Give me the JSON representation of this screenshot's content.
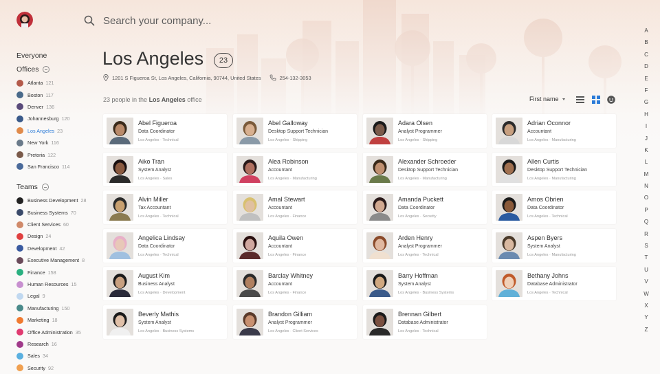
{
  "search": {
    "placeholder": "Search your company..."
  },
  "sidebar": {
    "everyone_label": "Everyone",
    "offices_label": "Offices",
    "teams_label": "Teams",
    "offices": [
      {
        "name": "Atlanta",
        "count": "121",
        "color": "#b45a4a"
      },
      {
        "name": "Boston",
        "count": "117",
        "color": "#4a6a8a"
      },
      {
        "name": "Denver",
        "count": "136",
        "color": "#5a4a7a"
      },
      {
        "name": "Johannesburg",
        "count": "120",
        "color": "#3a5a8a"
      },
      {
        "name": "Los Angeles",
        "count": "23",
        "color": "#e08a4a",
        "active": true
      },
      {
        "name": "New York",
        "count": "116",
        "color": "#6a7a8a"
      },
      {
        "name": "Pretoria",
        "count": "122",
        "color": "#7a5a4a"
      },
      {
        "name": "San Francisco",
        "count": "114",
        "color": "#4a6a9a"
      }
    ],
    "teams": [
      {
        "name": "Business Development",
        "count": "28",
        "color": "#222222"
      },
      {
        "name": "Business Systems",
        "count": "70",
        "color": "#3a4a6a"
      },
      {
        "name": "Client Services",
        "count": "60",
        "color": "#d08a6a"
      },
      {
        "name": "Design",
        "count": "24",
        "color": "#e04040"
      },
      {
        "name": "Development",
        "count": "42",
        "color": "#3a5aa0"
      },
      {
        "name": "Executive Management",
        "count": "8",
        "color": "#6a4a5a"
      },
      {
        "name": "Finance",
        "count": "158",
        "color": "#2ab080"
      },
      {
        "name": "Human Resources",
        "count": "15",
        "color": "#c890d0"
      },
      {
        "name": "Legal",
        "count": "9",
        "color": "#c0d8f0"
      },
      {
        "name": "Manufacturing",
        "count": "150",
        "color": "#4a8a8a"
      },
      {
        "name": "Marketing",
        "count": "18",
        "color": "#f07a30"
      },
      {
        "name": "Office Administration",
        "count": "35",
        "color": "#e03a70"
      },
      {
        "name": "Research",
        "count": "16",
        "color": "#a03a8a"
      },
      {
        "name": "Sales",
        "count": "34",
        "color": "#5ab0e0"
      },
      {
        "name": "Security",
        "count": "92",
        "color": "#f0a050"
      }
    ]
  },
  "office": {
    "title": "Los Angeles",
    "count": "23",
    "address": "1201 S Figueroa St, Los Angeles, California, 90744, United States",
    "phone": "254-132-3053",
    "summary_prefix": "23 people in the ",
    "summary_bold": "Los Angeles",
    "summary_suffix": " office"
  },
  "toolbar": {
    "sort_label": "First name"
  },
  "alphabet": [
    "A",
    "B",
    "C",
    "D",
    "E",
    "F",
    "G",
    "H",
    "I",
    "J",
    "K",
    "L",
    "M",
    "N",
    "O",
    "P",
    "Q",
    "R",
    "S",
    "T",
    "U",
    "V",
    "W",
    "X",
    "Y",
    "Z"
  ],
  "people": [
    {
      "name": "Abel Figueroa",
      "role": "Data Coordinator",
      "meta": "Los Angeles · Technical",
      "skin": "#b98a6a",
      "hair": "#3a2a1a",
      "shirt": "#5a6a7a"
    },
    {
      "name": "Abel Galloway",
      "role": "Desktop Support Technician",
      "meta": "Los Angeles · Shipping",
      "skin": "#d8b090",
      "hair": "#7a5a3a",
      "shirt": "#8a9aa8"
    },
    {
      "name": "Adara Olsen",
      "role": "Analyst Programmer",
      "meta": "Los Angeles · Shipping",
      "skin": "#7a5a4a",
      "hair": "#1a1a1a",
      "shirt": "#c04040"
    },
    {
      "name": "Adrian Oconnor",
      "role": "Accountant",
      "meta": "Los Angeles · Manufacturing",
      "skin": "#c8a080",
      "hair": "#2a2a2a",
      "shirt": "#d8d8d8"
    },
    {
      "name": "Aiko Tran",
      "role": "System Analyst",
      "meta": "Los Angeles · Sales",
      "skin": "#8a5a40",
      "hair": "#1a1010",
      "shirt": "#2a2a2a"
    },
    {
      "name": "Alea Robinson",
      "role": "Accountant",
      "meta": "Los Angeles · Manufacturing",
      "skin": "#b07060",
      "hair": "#2a1a1a",
      "shirt": "#d04060"
    },
    {
      "name": "Alexander Schroeder",
      "role": "Desktop Support Technician",
      "meta": "Los Angeles · Manufacturing",
      "skin": "#c09070",
      "hair": "#3a2a1a",
      "shirt": "#6a7a4a"
    },
    {
      "name": "Allen Curtis",
      "role": "Desktop Support Technician",
      "meta": "Los Angeles · Manufacturing",
      "skin": "#a07050",
      "hair": "#1a1a1a",
      "shirt": "#e0e0e0"
    },
    {
      "name": "Alvin Miller",
      "role": "Tax Accountant",
      "meta": "Los Angeles · Technical",
      "skin": "#c8a070",
      "hair": "#2a2a2a",
      "shirt": "#8a7a50"
    },
    {
      "name": "Amal Stewart",
      "role": "Accountant",
      "meta": "Los Angeles · Finance",
      "skin": "#e0c0a0",
      "hair": "#d8c070",
      "shirt": "#c0c0c0"
    },
    {
      "name": "Amanda Puckett",
      "role": "Data Coordinator",
      "meta": "Los Angeles · Security",
      "skin": "#d0a890",
      "hair": "#2a1a1a",
      "shirt": "#8a8a8a"
    },
    {
      "name": "Amos Obrien",
      "role": "Data Coordinator",
      "meta": "Los Angeles · Technical",
      "skin": "#8a5a3a",
      "hair": "#1a1a1a",
      "shirt": "#2a5aa0"
    },
    {
      "name": "Angelica Lindsay",
      "role": "Data Coordinator",
      "meta": "Los Angeles · Technical",
      "skin": "#e8c8b8",
      "hair": "#e8b0c8",
      "shirt": "#a0c0e0"
    },
    {
      "name": "Aquila Owen",
      "role": "Accountant",
      "meta": "Los Angeles · Finance",
      "skin": "#d0a8a0",
      "hair": "#2a1010",
      "shirt": "#5a2a2a"
    },
    {
      "name": "Arden Henry",
      "role": "Analyst Programmer",
      "meta": "Los Angeles · Technical",
      "skin": "#e0b8a0",
      "hair": "#8a4a2a",
      "shirt": "#f0e0d0"
    },
    {
      "name": "Aspen Byers",
      "role": "System Analyst",
      "meta": "Los Angeles · Manufacturing",
      "skin": "#d8b8a0",
      "hair": "#4a3a2a",
      "shirt": "#6a8ab0"
    },
    {
      "name": "August Kim",
      "role": "Business Analyst",
      "meta": "Los Angeles · Development",
      "skin": "#c8a080",
      "hair": "#1a1a1a",
      "shirt": "#2a2a3a"
    },
    {
      "name": "Barclay Whitney",
      "role": "Accountant",
      "meta": "Los Angeles · Finance",
      "skin": "#b08060",
      "hair": "#2a2a2a",
      "shirt": "#4a4a4a"
    },
    {
      "name": "Barry Hoffman",
      "role": "System Analyst",
      "meta": "Los Angeles · Business Systems",
      "skin": "#d0a880",
      "hair": "#1a1a1a",
      "shirt": "#3a5a8a"
    },
    {
      "name": "Bethany Johns",
      "role": "Database Administrator",
      "meta": "Los Angeles · Technical",
      "skin": "#f0d0b8",
      "hair": "#c05a2a",
      "shirt": "#60b0d8"
    },
    {
      "name": "Beverly Mathis",
      "role": "System Analyst",
      "meta": "Los Angeles · Business Systems",
      "skin": "#e0c0a8",
      "hair": "#1a1a1a",
      "shirt": "#f0f0f0"
    },
    {
      "name": "Brandon Gilliam",
      "role": "Analyst Programmer",
      "meta": "Los Angeles · Client Services",
      "skin": "#c89070",
      "hair": "#5a3a2a",
      "shirt": "#3a3a4a"
    },
    {
      "name": "Brennan Gilbert",
      "role": "Database Administrator",
      "meta": "Los Angeles · Technical",
      "skin": "#7a5040",
      "hair": "#1a1a1a",
      "shirt": "#2a2a2a"
    }
  ],
  "colors": {
    "accent": "#2b7bd8",
    "card_bg": "#ffffff",
    "page_bg": "#faf9f8"
  }
}
